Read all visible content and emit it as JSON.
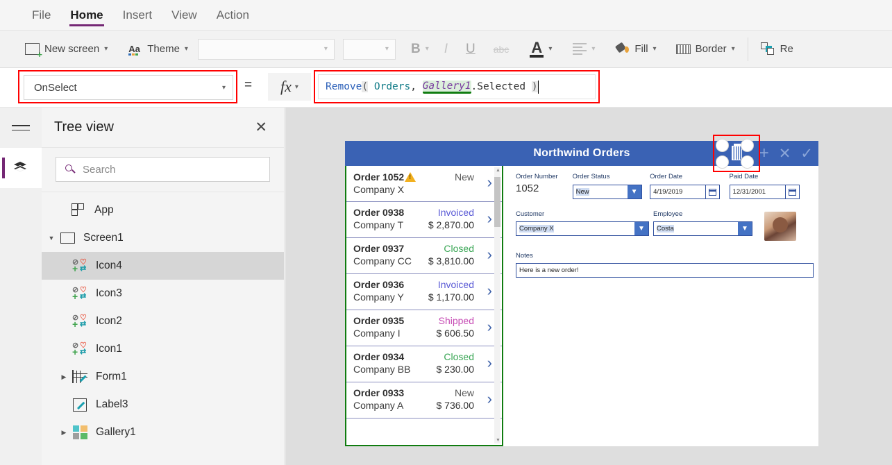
{
  "menubar": {
    "items": [
      {
        "label": "File",
        "active": false
      },
      {
        "label": "Home",
        "active": true
      },
      {
        "label": "Insert",
        "active": false
      },
      {
        "label": "View",
        "active": false
      },
      {
        "label": "Action",
        "active": false
      }
    ]
  },
  "toolbar": {
    "new_screen": "New screen",
    "theme": "Theme",
    "font_family_value": "",
    "font_size_value": "",
    "bold": "B",
    "italic": "I",
    "underline": "U",
    "strikethrough": "abc",
    "fill": "Fill",
    "border": "Border",
    "reorder": "Re"
  },
  "formula_bar": {
    "property": "OnSelect",
    "equals": "=",
    "fx": "fx",
    "formula_text": "Remove( Orders, Gallery1.Selected )",
    "tokens": {
      "fn": "Remove",
      "open_paren": "(",
      "table": " Orders",
      "comma": ", ",
      "control": "Gallery1",
      "dot_prop": ".Selected ",
      "close_paren": ")"
    }
  },
  "treeview": {
    "title": "Tree view",
    "close": "✕",
    "search_placeholder": "Search",
    "search_value": "",
    "items": [
      {
        "label": "App",
        "icon": "app-icon",
        "indent": 0,
        "caret": "",
        "selected": false
      },
      {
        "label": "Screen1",
        "icon": "screen-icon",
        "indent": 0,
        "caret": "▼",
        "selected": false
      },
      {
        "label": "Icon4",
        "icon": "icon-quad-icon",
        "indent": 2,
        "caret": "",
        "selected": true
      },
      {
        "label": "Icon3",
        "icon": "icon-quad-icon",
        "indent": 2,
        "caret": "",
        "selected": false
      },
      {
        "label": "Icon2",
        "icon": "icon-quad-icon",
        "indent": 2,
        "caret": "",
        "selected": false
      },
      {
        "label": "Icon1",
        "icon": "icon-quad-icon",
        "indent": 2,
        "caret": "",
        "selected": false
      },
      {
        "label": "Form1",
        "icon": "form-icon",
        "indent": 1,
        "caret": "▶",
        "selected": false
      },
      {
        "label": "Label3",
        "icon": "label-icon",
        "indent": 2,
        "caret": "",
        "selected": false
      },
      {
        "label": "Gallery1",
        "icon": "gallery-icon",
        "indent": 1,
        "caret": "▶",
        "selected": false
      }
    ]
  },
  "canvas": {
    "app_title": "Northwind Orders",
    "header_icons": [
      "delete-icon",
      "plus-icon",
      "cancel-icon",
      "check-icon"
    ],
    "gallery": [
      {
        "order": "Order 1052",
        "company": "Company X",
        "status": "New",
        "amount": "",
        "status_color": "#5a5a5a",
        "warning": true
      },
      {
        "order": "Order 0938",
        "company": "Company T",
        "status": "Invoiced",
        "amount": "$ 2,870.00",
        "status_color": "#5b5bd6",
        "warning": false
      },
      {
        "order": "Order 0937",
        "company": "Company CC",
        "status": "Closed",
        "amount": "$ 3,810.00",
        "status_color": "#3aa655",
        "warning": false
      },
      {
        "order": "Order 0936",
        "company": "Company Y",
        "status": "Invoiced",
        "amount": "$ 1,170.00",
        "status_color": "#5b5bd6",
        "warning": false
      },
      {
        "order": "Order 0935",
        "company": "Company I",
        "status": "Shipped",
        "amount": "$ 606.50",
        "status_color": "#c64bb4",
        "warning": false
      },
      {
        "order": "Order 0934",
        "company": "Company BB",
        "status": "Closed",
        "amount": "$ 230.00",
        "status_color": "#3aa655",
        "warning": false
      },
      {
        "order": "Order 0933",
        "company": "Company A",
        "status": "New",
        "amount": "$ 736.00",
        "status_color": "#5a5a5a",
        "warning": false
      }
    ],
    "form": {
      "order_number_label": "Order Number",
      "order_number_value": "1052",
      "order_status_label": "Order Status",
      "order_status_value": "New",
      "order_date_label": "Order Date",
      "order_date_value": "4/19/2019",
      "paid_date_label": "Paid Date",
      "paid_date_value": "12/31/2001",
      "customer_label": "Customer",
      "customer_value": "Company X",
      "employee_label": "Employee",
      "employee_value": "Costa",
      "notes_label": "Notes",
      "notes_value": "Here is a new order!"
    }
  },
  "colors": {
    "accent_purple": "#742774",
    "app_header_blue": "#3a62b4",
    "selection_red": "#ff0000",
    "selection_green": "#107c10",
    "canvas_gray": "#dedede"
  }
}
